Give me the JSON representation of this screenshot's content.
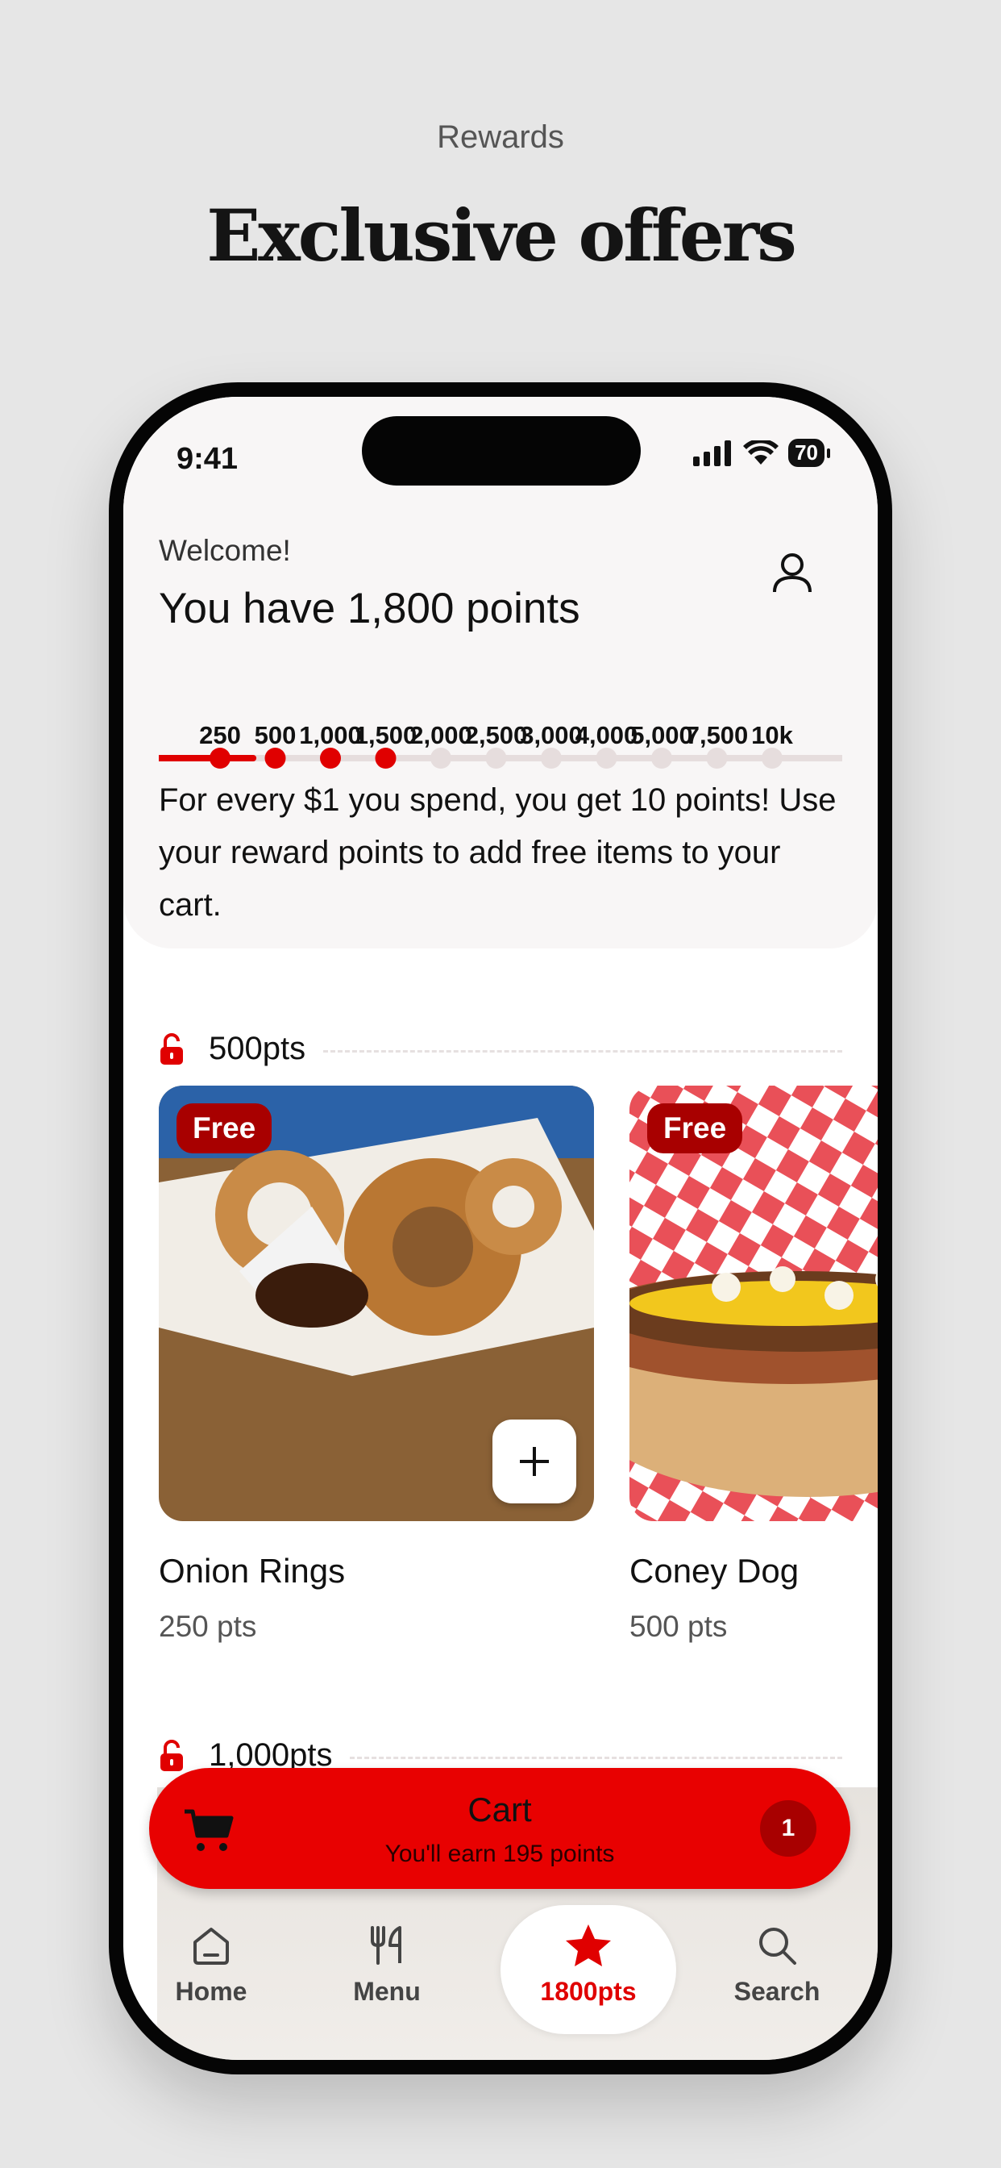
{
  "page": {
    "section_label": "Rewards",
    "headline": "Exclusive offers"
  },
  "status": {
    "time": "9:41",
    "battery": "70"
  },
  "header": {
    "welcome": "Welcome!",
    "points_text": "You have 1,800 points",
    "points_value": 1800,
    "milestones": [
      "250",
      "500",
      "1,000",
      "1,500",
      "2,000",
      "2,500",
      "3,000",
      "4,000",
      "5,000",
      "7,500",
      "10k"
    ],
    "reached_count": 4,
    "info": "For every $1 you spend, you get 10 points! Use your reward points to add free items to your cart."
  },
  "sections": [
    {
      "label": "500pts"
    },
    {
      "label": "1,000pts"
    }
  ],
  "items": [
    {
      "name": "Onion Rings",
      "points": "250 pts",
      "badge": "Free"
    },
    {
      "name": "Coney Dog",
      "points": "500 pts",
      "badge": "Free"
    }
  ],
  "cart": {
    "title": "Cart",
    "subtitle": "You'll earn 195 points",
    "count": "1"
  },
  "tabs": [
    {
      "label": "Home",
      "icon": "home-icon"
    },
    {
      "label": "Menu",
      "icon": "utensils-icon"
    },
    {
      "label": "1800pts",
      "icon": "star-icon",
      "active": true
    },
    {
      "label": "Search",
      "icon": "search-icon"
    }
  ],
  "colors": {
    "accent": "#E80101",
    "badge": "#A80000",
    "background": "#E6E6E6"
  }
}
